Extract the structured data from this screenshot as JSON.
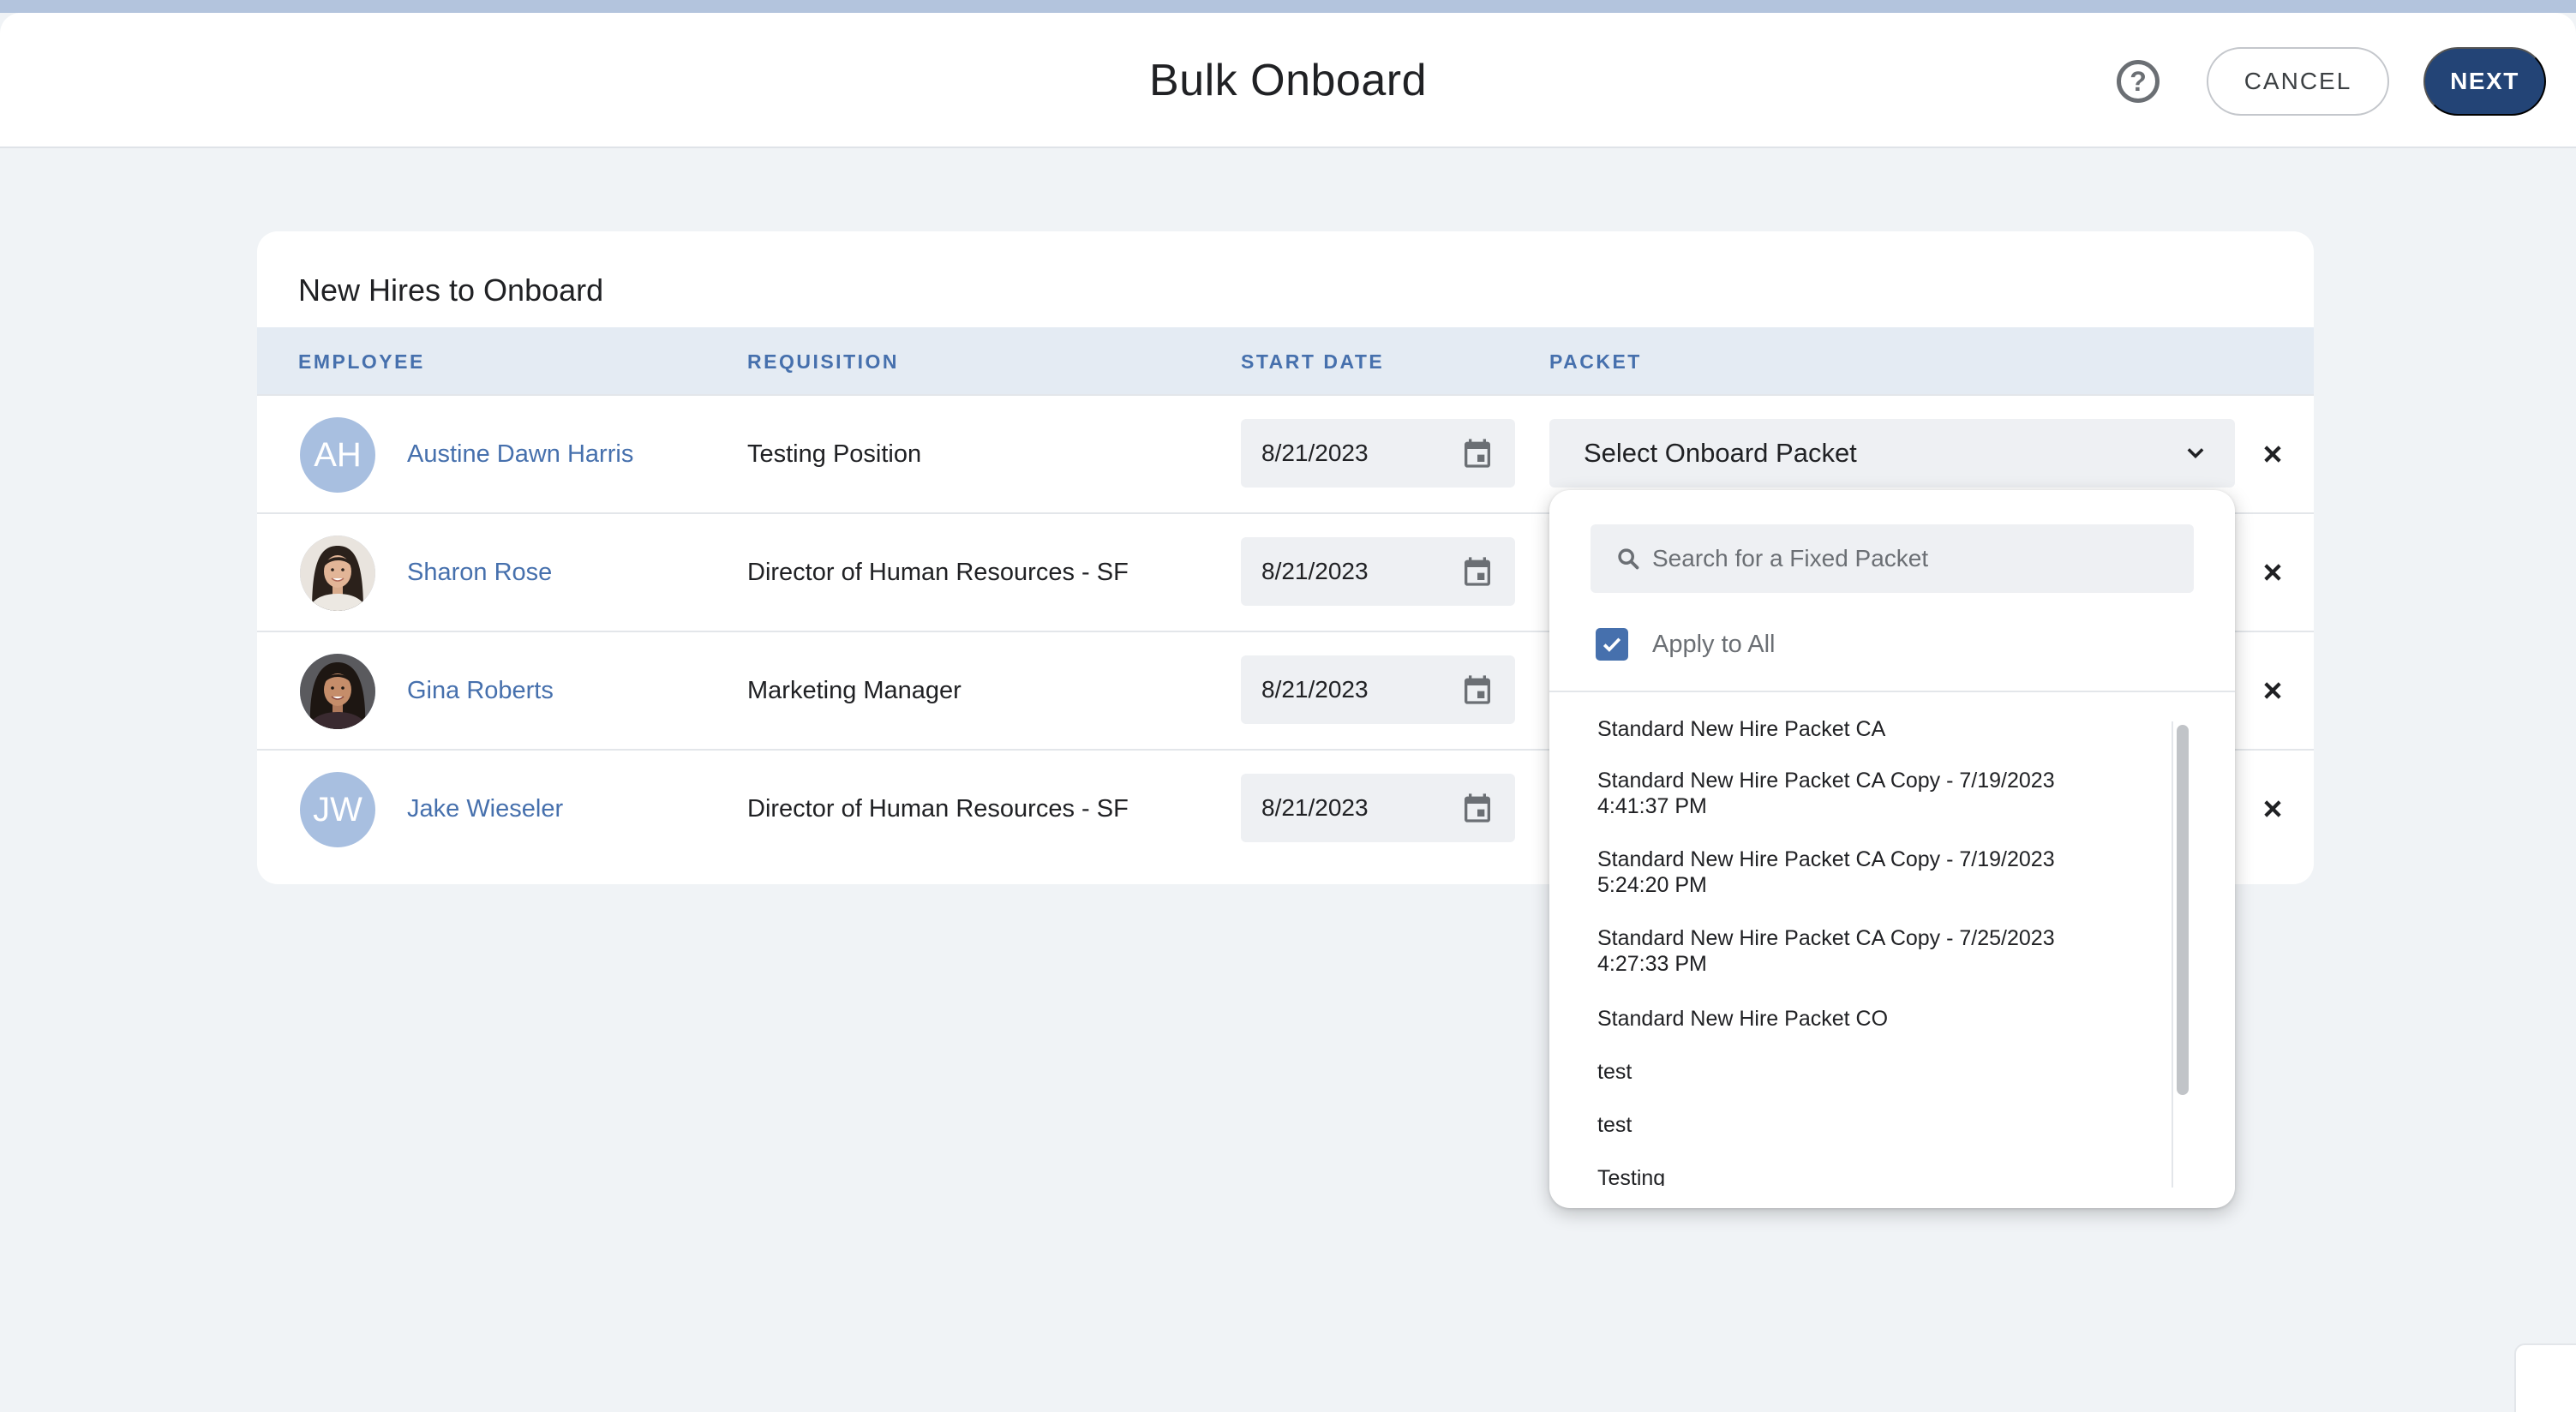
{
  "header": {
    "title": "Bulk Onboard",
    "help_symbol": "?",
    "cancel_label": "CANCEL",
    "next_label": "NEXT",
    "help_icon": "help-circle-icon"
  },
  "card": {
    "title": "New Hires to Onboard",
    "columns": {
      "employee": "EMPLOYEE",
      "requisition": "REQUISITION",
      "start_date": "START DATE",
      "packet": "PACKET"
    },
    "rows": [
      {
        "initials": "AH",
        "name": "Austine Dawn Harris",
        "requisition": "Testing Position",
        "start_date": "8/21/2023",
        "avatar": "initials"
      },
      {
        "initials": "",
        "name": "Sharon Rose",
        "requisition": "Director of Human Resources - SF",
        "start_date": "8/21/2023",
        "avatar": "photo"
      },
      {
        "initials": "",
        "name": "Gina Roberts",
        "requisition": "Marketing Manager",
        "start_date": "8/21/2023",
        "avatar": "photo"
      },
      {
        "initials": "JW",
        "name": "Jake Wieseler",
        "requisition": "Director of Human Resources - SF",
        "start_date": "8/21/2023",
        "avatar": "initials"
      }
    ],
    "packet_select_label": "Select Onboard Packet"
  },
  "dropdown": {
    "search_placeholder": "Search for a Fixed Packet",
    "apply_to_all_label": "Apply to All",
    "apply_to_all_checked": true,
    "options": [
      [
        "Standard New Hire Packet CA"
      ],
      [
        "Standard New Hire Packet CA Copy - 7/19/2023",
        "4:41:37 PM"
      ],
      [
        "Standard New Hire Packet CA Copy - 7/19/2023",
        "5:24:20 PM"
      ],
      [
        "Standard New Hire Packet CA Copy - 7/25/2023",
        "4:27:33 PM"
      ],
      [
        "Standard New Hire Packet CO"
      ],
      [
        "test"
      ],
      [
        "test"
      ],
      [
        "Testing"
      ]
    ]
  },
  "colors": {
    "accent": "#4670ad",
    "primary_button": "#234476",
    "table_header_bg": "#e4ebf3",
    "avatar_bg": "#a8bfe0"
  },
  "icons": {
    "calendar": "calendar-icon",
    "chevron": "chevron-down-icon",
    "remove": "close-icon",
    "search": "search-icon",
    "check": "check-icon"
  }
}
